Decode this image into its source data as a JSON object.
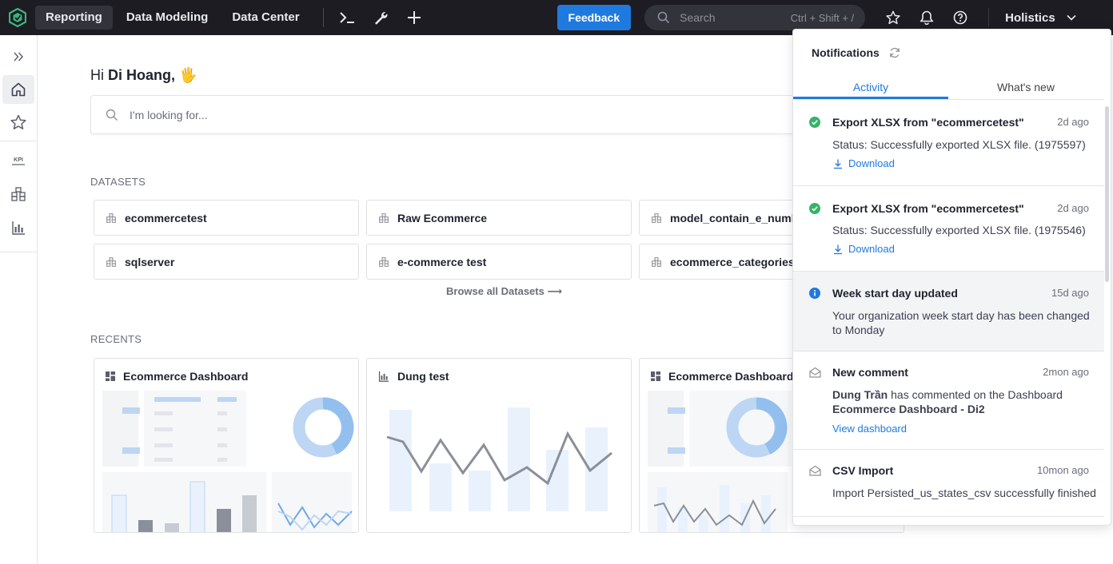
{
  "topbar": {
    "nav": [
      "Reporting",
      "Data Modeling",
      "Data Center"
    ],
    "feedback_label": "Feedback",
    "search_placeholder": "Search",
    "search_hint": "Ctrl + Shift + /",
    "org_name": "Holistics",
    "colors": {
      "bar": "#1c1c22",
      "feedback": "#1f7ae0",
      "logo": "#3fb37f"
    }
  },
  "sidebar": {
    "items": [
      "expand-icon",
      "home-icon",
      "star-icon",
      "kpi-icon",
      "dataset-icon",
      "report-icon"
    ],
    "kpi_text": "KPI"
  },
  "main": {
    "greeting_prefix": "Hi",
    "user_name": "Di Hoang,",
    "greeting_emoji": "🖐",
    "search_placeholder": "I'm looking for...",
    "datasets_label": "DATASETS",
    "datasets": [
      "ecommercetest",
      "Raw Ecommerce",
      "model_contain_e_number",
      "sqlserver",
      "e-commerce test",
      "ecommerce_categories_"
    ],
    "browse_label": "Browse all Datasets ⟶",
    "recents_label": "RECENTS",
    "recents": [
      "Ecommerce Dashboard",
      "Dung test",
      "Ecommerce Dashboard"
    ]
  },
  "notifications": {
    "title": "Notifications",
    "tabs": [
      "Activity",
      "What's new"
    ],
    "items": [
      {
        "icon": "check-circle-icon",
        "title": "Export XLSX from \"ecommercetest\"",
        "time": "2d ago",
        "body": "Status: Successfully exported XLSX file. (1975597)",
        "link": "Download"
      },
      {
        "icon": "check-circle-icon",
        "title": "Export XLSX from \"ecommercetest\"",
        "time": "2d ago",
        "body": "Status: Successfully exported XLSX file. (1975546)",
        "link": "Download"
      },
      {
        "icon": "info-icon",
        "title": "Week start day updated",
        "time": "15d ago",
        "body": "Your organization week start day has been changed to Monday"
      },
      {
        "icon": "envelope-icon",
        "title": "New comment",
        "time": "2mon ago",
        "body_user": "Dung Trần",
        "body_mid": "has commented on the Dashboard",
        "body_target": "Ecommerce Dashboard - Di2",
        "link": "View dashboard"
      },
      {
        "icon": "envelope-icon",
        "title": "CSV Import",
        "time": "10mon ago",
        "body": "Import Persisted_us_states_csv successfully finished"
      }
    ],
    "colors": {
      "success": "#37b26c",
      "info": "#1f7ae0",
      "link": "#1f7ae0"
    }
  }
}
